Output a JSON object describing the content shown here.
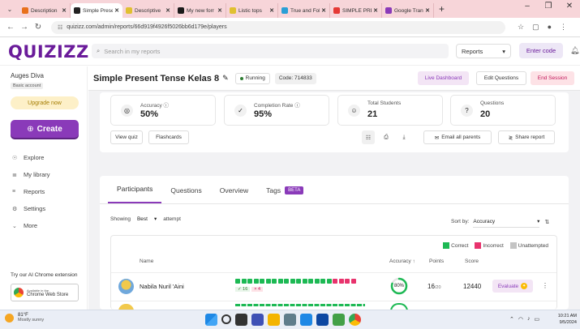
{
  "browser": {
    "tabs": [
      {
        "label": "Description",
        "color": "#e8711c",
        "active": false
      },
      {
        "label": "Simple Prese",
        "color": "#222222",
        "active": true
      },
      {
        "label": "Descriptive",
        "color": "#e0c030",
        "active": false
      },
      {
        "label": "My new forr",
        "color": "#1a1a1a",
        "active": false
      },
      {
        "label": "Listic tops",
        "color": "#e0c030",
        "active": false
      },
      {
        "label": "True and Fol",
        "color": "#2a9fd6",
        "active": false
      },
      {
        "label": "SIMPLE PRE",
        "color": "#e53935",
        "active": false
      },
      {
        "label": "Google Tran",
        "color": "#8a3ab9",
        "active": false
      }
    ],
    "new_tab": "+",
    "url": "quizizz.com/admin/reports/66d919f4926f5026bb6d179e/players"
  },
  "header": {
    "logo": "QUIZIZZ",
    "search_placeholder": "Search in my reports",
    "reports_dropdown": "Reports",
    "enter_code": "Enter code"
  },
  "sidebar": {
    "user_name": "Auges Diva",
    "account_type": "Basic account",
    "upgrade": "Upgrade now",
    "create": "Create",
    "items": [
      {
        "label": "Explore",
        "icon": "compass-icon"
      },
      {
        "label": "My library",
        "icon": "library-icon"
      },
      {
        "label": "Reports",
        "icon": "reports-icon"
      },
      {
        "label": "Settings",
        "icon": "gear-icon"
      },
      {
        "label": "More",
        "icon": "chevron-down-icon"
      }
    ],
    "extension_promo": "Try our AI Chrome extension",
    "store_line1": "Available in the",
    "store_line2": "Chrome Web Store"
  },
  "quiz": {
    "title": "Simple Present Tense Kelas 8",
    "status": "Running",
    "code": "Code: 714833",
    "live_dashboard": "Live Dashboard",
    "edit_questions": "Edit Questions",
    "end_session": "End Session"
  },
  "stats": [
    {
      "label": "Accuracy ⓘ",
      "value": "50%",
      "icon": "target-icon"
    },
    {
      "label": "Completion Rate ⓘ",
      "value": "95%",
      "icon": "check-circle-icon"
    },
    {
      "label": "Total Students",
      "value": "21",
      "icon": "students-icon"
    },
    {
      "label": "Questions",
      "value": "20",
      "icon": "question-icon"
    }
  ],
  "actions": {
    "view_quiz": "View quiz",
    "flashcards": "Flashcards",
    "email_parents": "Email all parents",
    "share_report": "Share report"
  },
  "tabs": {
    "participants": "Participants",
    "questions": "Questions",
    "overview": "Overview",
    "tags": "Tags",
    "beta": "BETA"
  },
  "filters": {
    "showing": "Showing",
    "best": "Best",
    "attempt": "attempt",
    "sort_by": "Sort by:",
    "sort_value": "Accuracy"
  },
  "legend": {
    "correct": "Correct",
    "incorrect": "Incorrect",
    "unattempted": "Unattempted",
    "colors": {
      "correct": "#1db954",
      "incorrect": "#e8336d",
      "unattempted": "#c4c4c4"
    }
  },
  "columns": {
    "name": "Name",
    "accuracy": "Accuracy ↑",
    "points": "Points",
    "score": "Score"
  },
  "participants": [
    {
      "name": "Nabila Nuril 'Aini",
      "correct": 16,
      "incorrect": 4,
      "correct_tally": "✓ 16",
      "incorrect_tally": "× 4",
      "accuracy": "80%",
      "accuracy_fraction": 0.8,
      "points": "16",
      "points_total": "/20",
      "score": "12440",
      "evaluate": "Evaluate"
    }
  ],
  "taskbar": {
    "temp": "81°F",
    "weather": "Mostly sunny",
    "time": "10:21 AM",
    "date": "9/5/2024"
  }
}
